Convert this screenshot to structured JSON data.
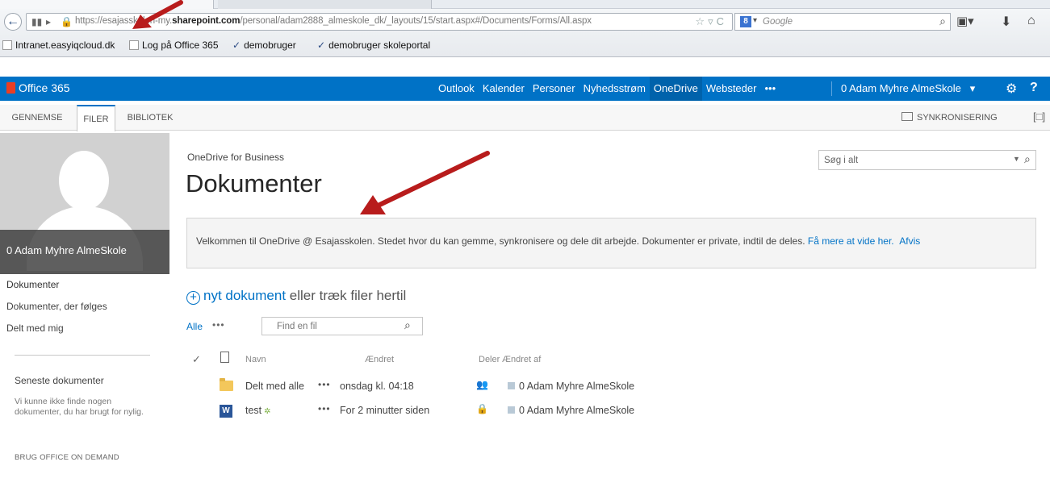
{
  "browser": {
    "url_plain_prefix": "https://esajasskolen-my.",
    "url_bold": "sharepoint.com",
    "url_rest": "/personal/adam2888_almeskole_dk/_layouts/15/start.aspx#/Documents/Forms/All.aspx",
    "search_placeholder": "Google",
    "bookmarks": [
      "Intranet.easyiqcloud.dk",
      "Log på Office 365",
      "demobruger",
      "demobruger skoleportal"
    ]
  },
  "suitebar": {
    "brand": "Office 365",
    "nav": [
      "Outlook",
      "Kalender",
      "Personer",
      "Nyhedsstrøm",
      "OneDrive",
      "Websteder",
      "•••"
    ],
    "active_nav": "OneDrive",
    "user": "0 Adam Myhre AlmeSkole",
    "user_caret": "▾",
    "help": "?"
  },
  "ribbon": {
    "tabs": [
      "GENNEMSE",
      "FILER",
      "BIBLIOTEK"
    ],
    "active_tab": "FILER",
    "sync_label": "SYNKRONISERING"
  },
  "profile": {
    "name": "0 Adam Myhre AlmeSkole"
  },
  "leftnav": {
    "items": [
      "Dokumenter",
      "Dokumenter, der følges",
      "Delt med mig"
    ],
    "recent_heading": "Seneste dokumenter",
    "recent_empty": "Vi kunne ikke finde nogen dokumenter, du har brugt for nylig.",
    "ondemand": "BRUG OFFICE ON DEMAND"
  },
  "main": {
    "breadcrumb": "OneDrive for Business",
    "title": "Dokumenter",
    "search_placeholder": "Søg i alt",
    "welcome_text": "Velkommen til OneDrive @ Esajasskolen. Stedet hvor du kan gemme, synkronisere og dele dit arbejde. Dokumenter er private, indtil de deles.",
    "welcome_link": "Få mere at vide her.",
    "welcome_dismiss": "Afvis",
    "new_doc_link": "nyt dokument",
    "new_doc_rest": " eller træk filer hertil",
    "filter_all": "Alle",
    "filter_more": "•••",
    "find_placeholder": "Find en fil",
    "columns": {
      "check": "✓",
      "name": "Navn",
      "modified": "Ændret",
      "shared": "Deler",
      "modified_by": "Ændret af"
    },
    "rows": [
      {
        "type": "folder",
        "name": "Delt med alle",
        "dots": "•••",
        "modified": "onsdag kl. 04:18",
        "shared": "people-icon",
        "modified_by": "0 Adam Myhre AlmeSkole",
        "new": false
      },
      {
        "type": "word",
        "name": "test",
        "dots": "•••",
        "modified": "For 2 minutter siden",
        "shared": "lock-icon",
        "modified_by": "0 Adam Myhre AlmeSkole",
        "new": true
      }
    ]
  },
  "colors": {
    "suite_blue": "#0072c6",
    "link_blue": "#0072c6",
    "arrow_red": "#b81c1c",
    "office_red": "#ea3e23"
  }
}
